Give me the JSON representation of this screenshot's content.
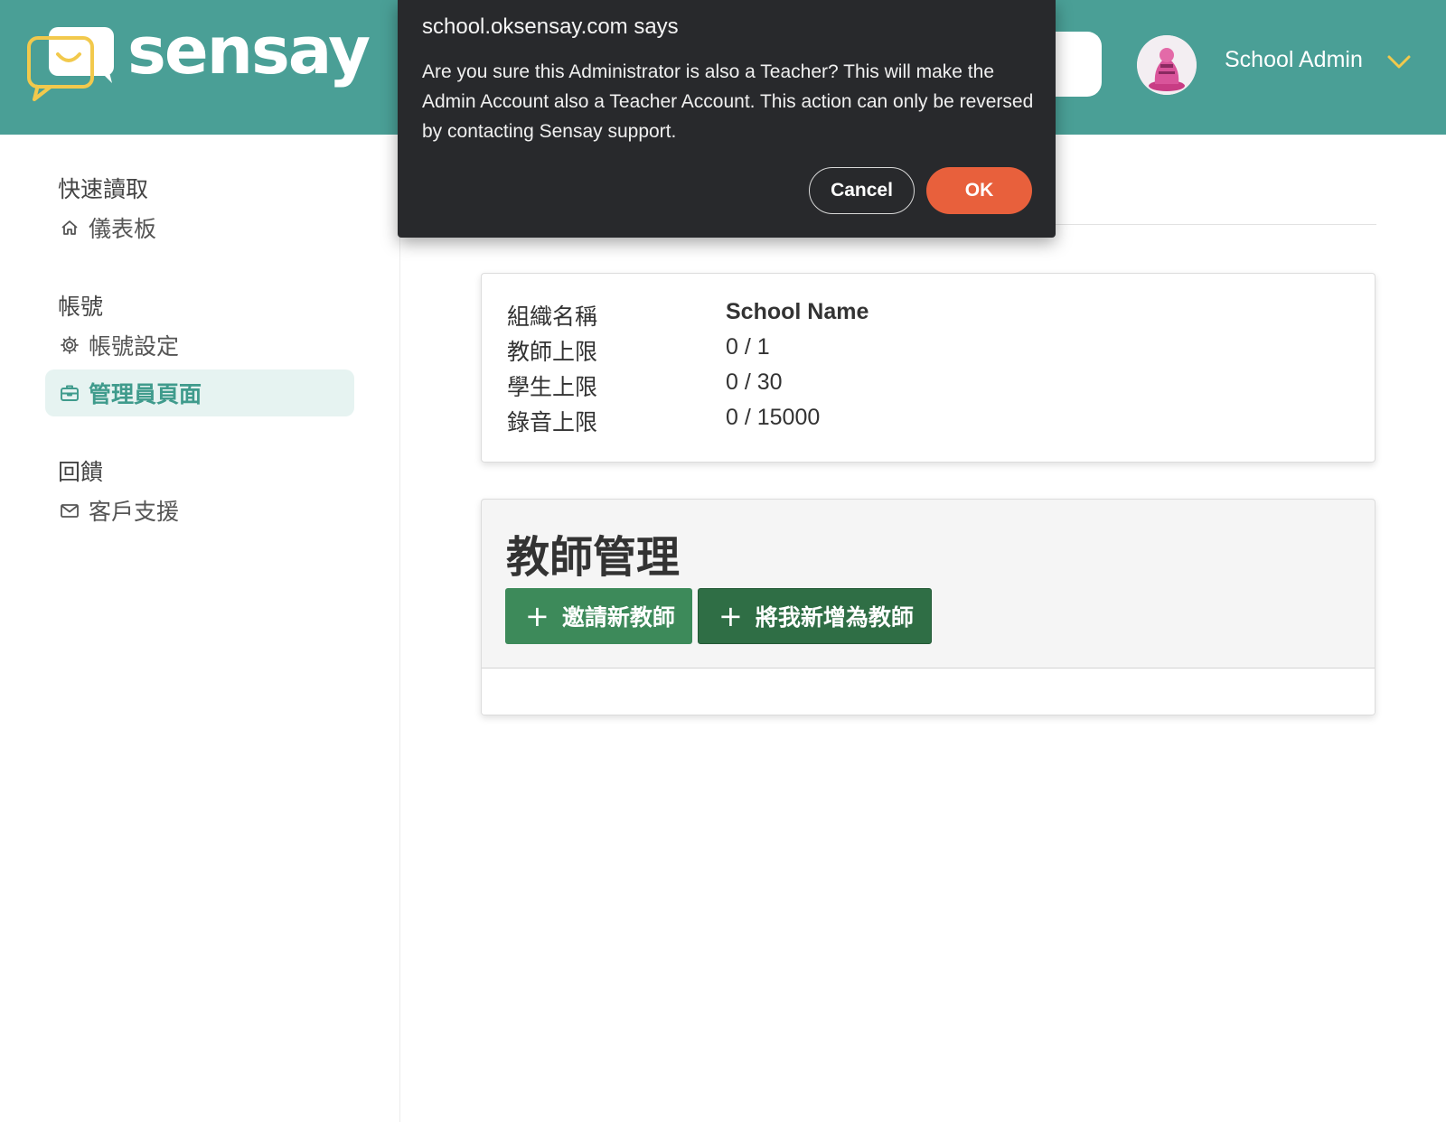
{
  "header": {
    "brand": "sensay",
    "user_name": "School Admin"
  },
  "sidebar": {
    "sections": [
      {
        "title": "快速讀取",
        "items": [
          {
            "label": "儀表板",
            "icon": "home-icon"
          }
        ]
      },
      {
        "title": "帳號",
        "items": [
          {
            "label": "帳號設定",
            "icon": "gear-icon"
          },
          {
            "label": "管理員頁面",
            "icon": "briefcase-icon",
            "active": true
          }
        ]
      },
      {
        "title": "回饋",
        "items": [
          {
            "label": "客戶支援",
            "icon": "mail-icon"
          }
        ]
      }
    ]
  },
  "info": {
    "rows": [
      {
        "label": "組織名稱",
        "value": "School Name"
      },
      {
        "label": "教師上限",
        "value": "0 / 1"
      },
      {
        "label": "學生上限",
        "value": "0 / 30"
      },
      {
        "label": "錄音上限",
        "value": "0 / 15000"
      }
    ]
  },
  "teacher_mgmt": {
    "title": "教師管理",
    "invite_label": "邀請新教師",
    "add_self_label": "將我新增為教師"
  },
  "dialog": {
    "title": "school.oksensay.com says",
    "message": "Are you sure this Administrator is also a Teacher? This will make the Admin Account also a Teacher Account. This action can only be reversed by contacting Sensay support.",
    "cancel_label": "Cancel",
    "ok_label": "OK"
  },
  "colors": {
    "header_bg": "#4a9f96",
    "accent": "#3f9b8c",
    "button_green": "#3d8a5a",
    "ok_button": "#e8603c",
    "dialog_bg": "#28292c"
  }
}
